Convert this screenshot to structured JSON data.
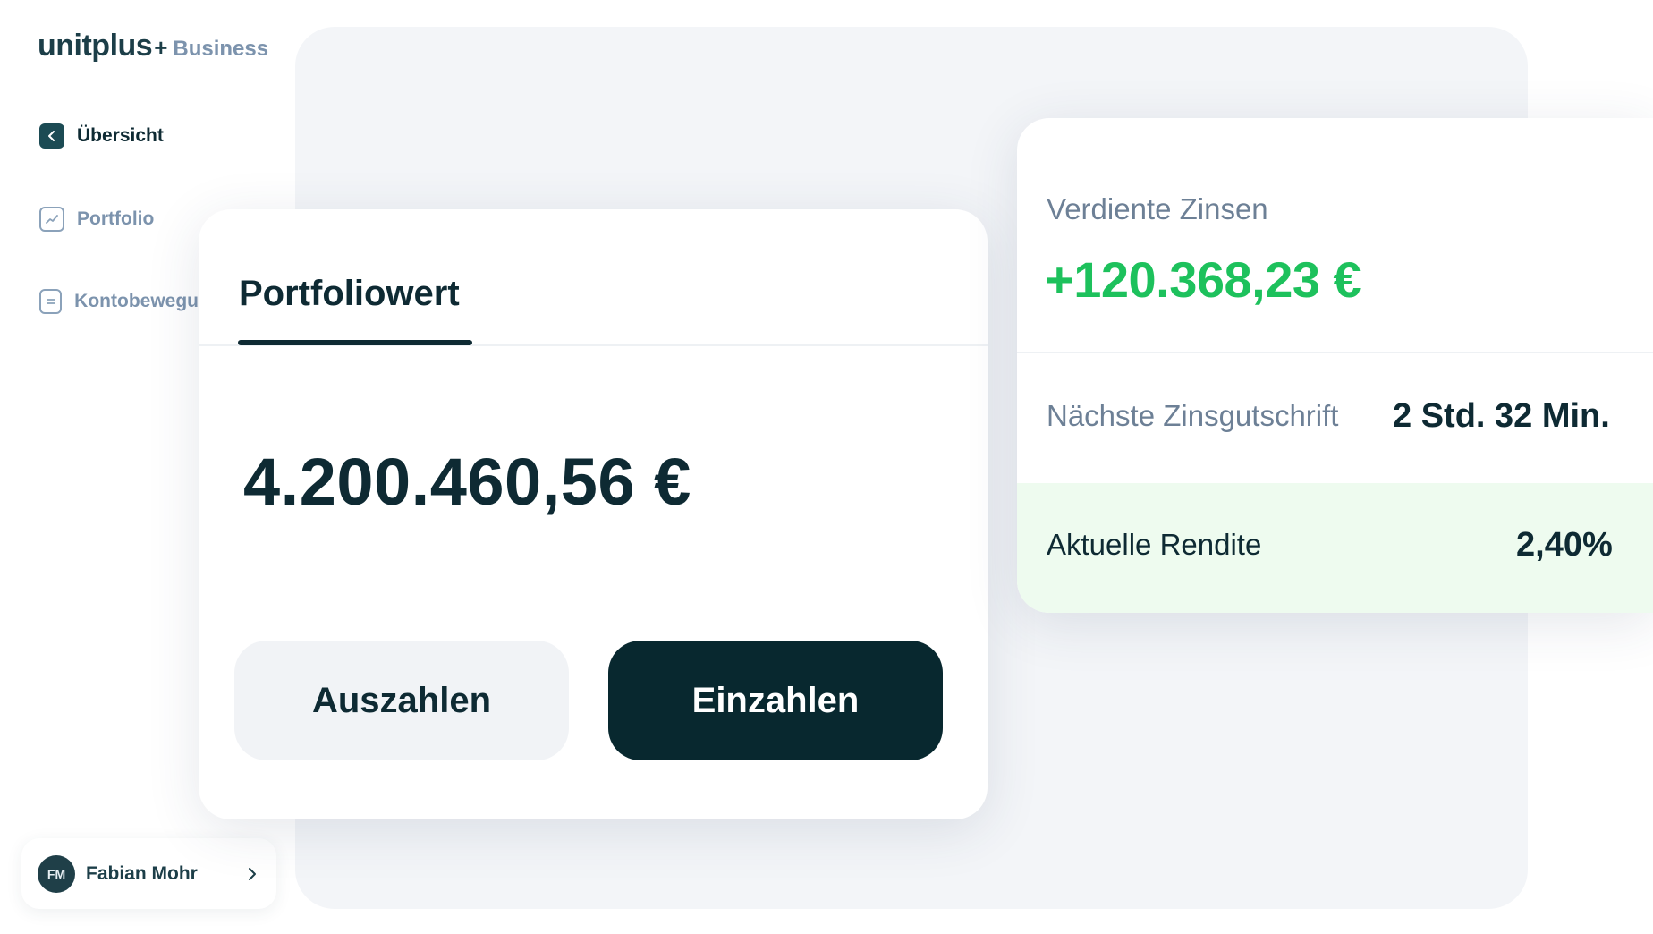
{
  "brand": {
    "name": "unitplus",
    "mark": "+",
    "sub": "Business"
  },
  "nav": {
    "items": [
      {
        "label": "Übersicht",
        "active": true
      },
      {
        "label": "Portfolio",
        "active": false
      },
      {
        "label": "Kontobewegu",
        "active": false
      }
    ]
  },
  "user": {
    "initials": "FM",
    "name": "Fabian Mohr"
  },
  "portfolio": {
    "tab_label": "Portfoliowert",
    "value": "4.200.460,56 €",
    "withdraw_label": "Auszahlen",
    "deposit_label": "Einzahlen"
  },
  "interest": {
    "earned_label": "Verdiente Zinsen",
    "earned_value": "+120.368,23 €",
    "next_label": "Nächste Zinsgutschrift",
    "next_value": "2 Std. 32 Min.",
    "rendite_label": "Aktuelle Rendite",
    "rendite_value": "2,40%"
  },
  "colors": {
    "primary": "#08282f",
    "positive": "#1dc15c",
    "muted": "#7c93ad",
    "highlight_bg": "#eefbef"
  }
}
